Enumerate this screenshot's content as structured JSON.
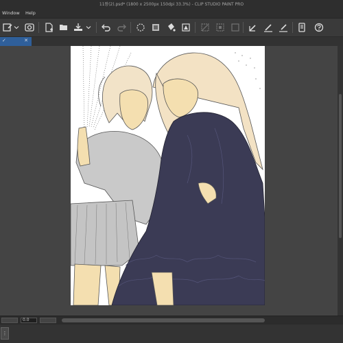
{
  "window": {
    "title": "11장(2).psd* (1800 x 2500px 150dpi 33.3%) - CLIP STUDIO PAINT PRO"
  },
  "menu": {
    "items": [
      {
        "label": "Window"
      },
      {
        "label": "Help"
      }
    ]
  },
  "toolbar": {
    "icons": [
      "new-canvas-icon",
      "chevron-down-icon",
      "clip-studio-icon",
      "new-file-icon",
      "open-file-icon",
      "save-icon",
      "chevron-down-icon",
      "undo-icon",
      "redo-icon",
      "clear-icon",
      "fill-icon",
      "transform-icon",
      "deselect-icon",
      "invert-selection-icon",
      "crop-icon",
      "pen-settings-icon",
      "brush-settings-icon",
      "eraser-settings-icon",
      "smartphone-icon",
      "help-icon"
    ]
  },
  "tabs": [
    {
      "label": "✓",
      "active": true
    }
  ],
  "status": {
    "zoom_value": "0.0"
  },
  "bottom": {
    "button_label": "⋮"
  },
  "colors": {
    "accent": "#2f5f9a",
    "dress": "#3b3b55",
    "skin_flat": "#f4dfb0"
  }
}
